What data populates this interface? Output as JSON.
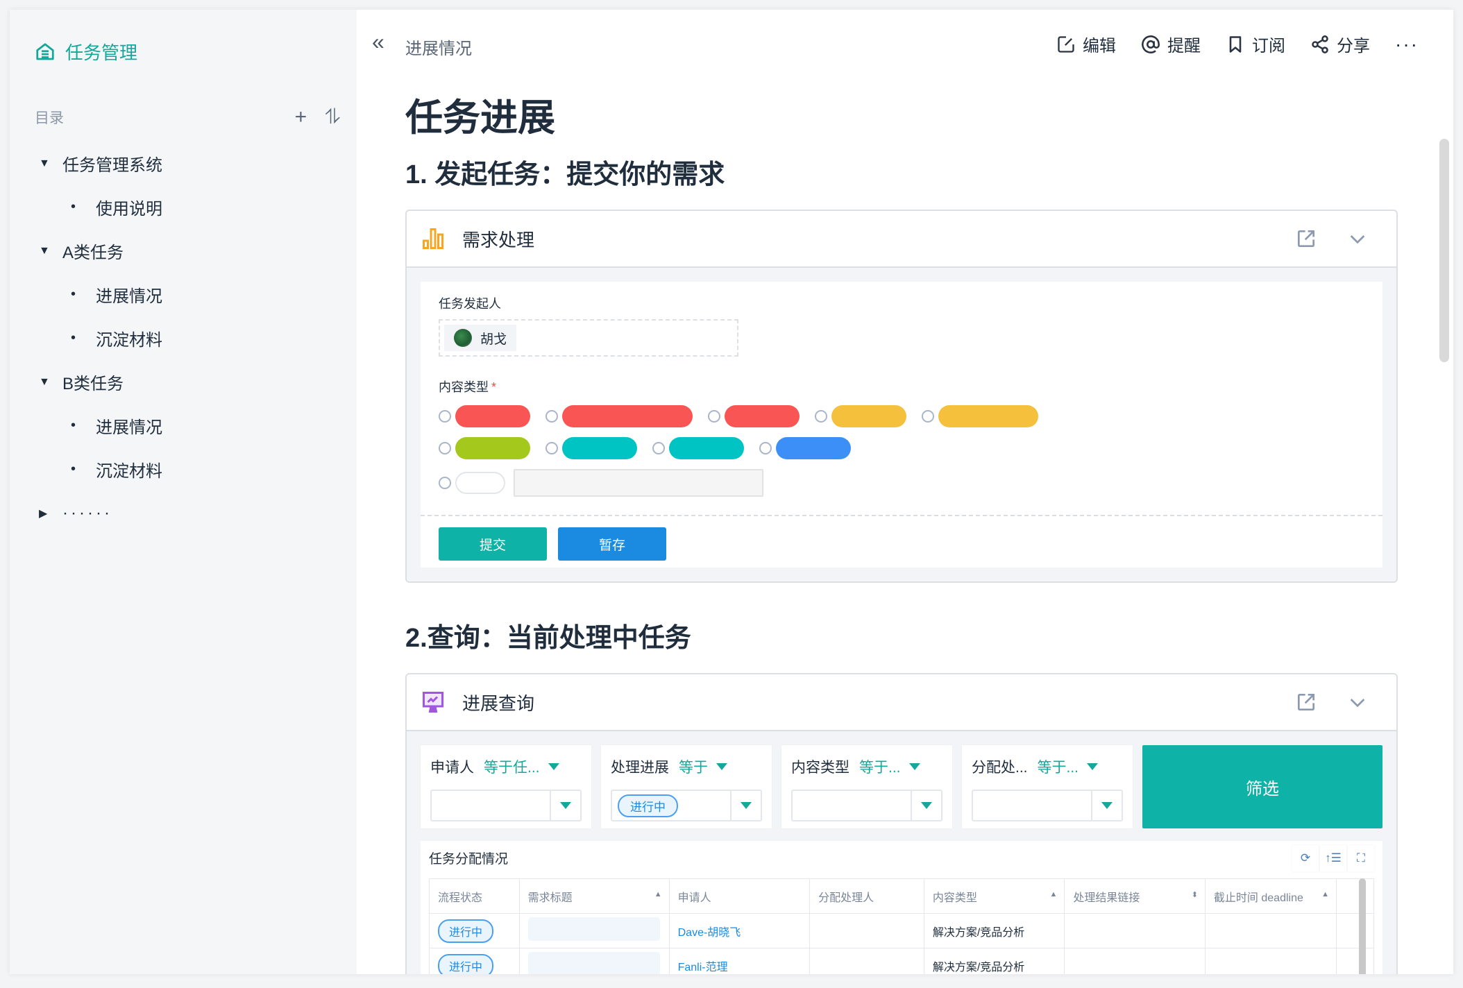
{
  "sidebar": {
    "brand": "任务管理",
    "toc_label": "目录",
    "add_icon": "+",
    "sort_icon": "⥮",
    "items": [
      {
        "label": "任务管理系统",
        "level": 0,
        "expanded": true
      },
      {
        "label": "使用说明",
        "level": 1
      },
      {
        "label": "A类任务",
        "level": 0,
        "expanded": true
      },
      {
        "label": "进展情况",
        "level": 1
      },
      {
        "label": "沉淀材料",
        "level": 1
      },
      {
        "label": "B类任务",
        "level": 0,
        "expanded": true
      },
      {
        "label": "进展情况",
        "level": 1
      },
      {
        "label": "沉淀材料",
        "level": 1
      },
      {
        "label": "······",
        "level": 0,
        "expanded": false
      }
    ]
  },
  "header": {
    "collapse_icon": "«",
    "breadcrumb": "进展情况",
    "actions": {
      "edit": "编辑",
      "mention": "提醒",
      "subscribe": "订阅",
      "share": "分享",
      "more": "···"
    }
  },
  "page": {
    "title": "任务进展",
    "section1_title": "1. 发起任务：提交你的需求",
    "section2_title": "2.查询：当前处理中任务"
  },
  "request_card": {
    "title": "需求处理",
    "initiator_label": "任务发起人",
    "initiator_name": "胡戈",
    "content_type_label": "内容类型",
    "required_mark": "*",
    "option_colors": [
      "#fa5555",
      "#fa5555",
      "#fa5555",
      "#f5c03b",
      "#f5c03b",
      "#a4c81b",
      "#00c3c3",
      "#00c3c3",
      "#3d8ff8"
    ],
    "submit_label": "提交",
    "draft_label": "暂存"
  },
  "query_card": {
    "title": "进展查询",
    "filters": [
      {
        "name": "申请人",
        "op": "等于任...",
        "value": ""
      },
      {
        "name": "处理进展",
        "op": "等于",
        "value": "进行中"
      },
      {
        "name": "内容类型",
        "op": "等于...",
        "value": ""
      },
      {
        "name": "分配处...",
        "op": "等于...",
        "value": ""
      }
    ],
    "filter_button": "筛选",
    "table": {
      "title": "任务分配情况",
      "tools": {
        "refresh": "⟳",
        "sort": "↑☰",
        "fullscreen": "⛶"
      },
      "columns": [
        {
          "label": "流程状态",
          "sort": ""
        },
        {
          "label": "需求标题",
          "sort": "▲"
        },
        {
          "label": "申请人",
          "sort": ""
        },
        {
          "label": "分配处理人",
          "sort": ""
        },
        {
          "label": "内容类型",
          "sort": "▲"
        },
        {
          "label": "处理结果链接",
          "sort": "⬍"
        },
        {
          "label": "截止时间 deadline",
          "sort": "▲"
        },
        {
          "label": "",
          "sort": ""
        }
      ],
      "rows": [
        {
          "status": "进行中",
          "title": "",
          "applicant": "Dave-胡晓飞",
          "assignee": "",
          "content_type": "解决方案/竞品分析",
          "result_link": "",
          "deadline": ""
        },
        {
          "status": "进行中",
          "title": "",
          "applicant": "Fanli-范理",
          "assignee": "",
          "content_type": "解决方案/竞品分析",
          "result_link": "",
          "deadline": ""
        }
      ]
    }
  }
}
